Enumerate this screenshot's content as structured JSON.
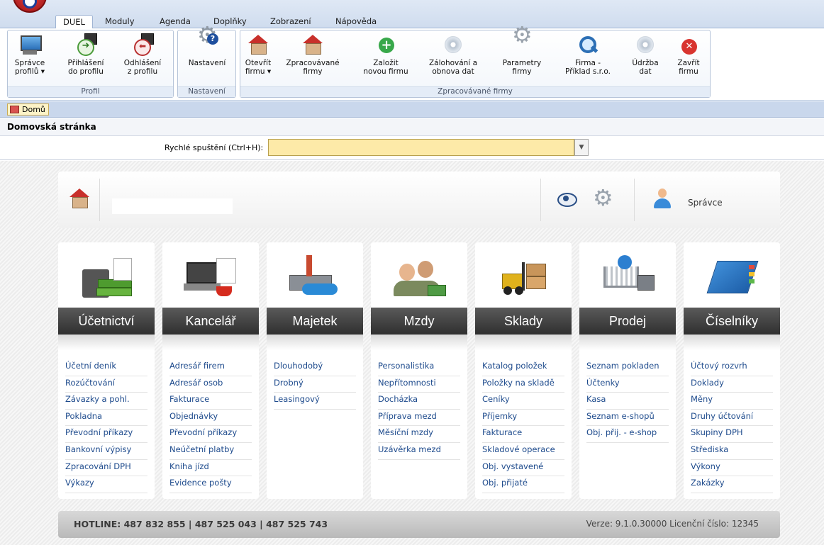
{
  "tabs": [
    "DUEL",
    "Moduly",
    "Agenda",
    "Doplňky",
    "Zobrazení",
    "Nápověda"
  ],
  "ribbon": {
    "groups": {
      "profil": "Profil",
      "nastaveni": "Nastavení",
      "firmy": "Zpracovávané firmy"
    },
    "buttons": {
      "spravce": [
        "Správce",
        "profilů ▾"
      ],
      "prihlaseni": [
        "Přihlášení",
        "do profilu"
      ],
      "odhlaseni": [
        "Odhlášení",
        "z profilu"
      ],
      "nastaveni": [
        "Nastavení"
      ],
      "otevrit": [
        "Otevřít",
        "firmu ▾"
      ],
      "zpracovavane": [
        "Zpracovávané",
        "firmy"
      ],
      "zalozit": [
        "Založit",
        "novou firmu"
      ],
      "zalohovani": [
        "Zálohování a",
        "obnova dat"
      ],
      "parametry": [
        "Parametry",
        "firmy"
      ],
      "firma": [
        "Firma -",
        "Příklad s.r.o."
      ],
      "udrzba": [
        "Údržba",
        "dat"
      ],
      "zavrit": [
        "Zavřít",
        "firmu"
      ]
    }
  },
  "breadcrumb": "Domů",
  "page_title": "Domovská stránka",
  "quick_launch": {
    "label": "Rychlé spuštění (Ctrl+H):",
    "value": ""
  },
  "user": "Správce",
  "modules": [
    {
      "title": "Účetnictví",
      "items": [
        "Účetní deník",
        "Rozúčtování",
        "Závazky a pohl.",
        "Pokladna",
        "Převodní příkazy",
        "Bankovní výpisy",
        "Zpracování DPH",
        "Výkazy"
      ]
    },
    {
      "title": "Kancelář",
      "items": [
        "Adresář firem",
        "Adresář osob",
        "Fakturace",
        "Objednávky",
        "Převodní příkazy",
        "Neúčetní platby",
        "Kniha jízd",
        "Evidence pošty"
      ]
    },
    {
      "title": "Majetek",
      "items": [
        "Dlouhodobý",
        "Drobný",
        "Leasingový"
      ]
    },
    {
      "title": "Mzdy",
      "items": [
        "Personalistika",
        "Nepřítomnosti",
        "Docházka",
        "Příprava mezd",
        "Měsíční mzdy",
        "Uzávěrka mezd"
      ]
    },
    {
      "title": "Sklady",
      "items": [
        "Katalog položek",
        "Položky na skladě",
        "Ceníky",
        "Příjemky",
        "Fakturace",
        "Skladové operace",
        "Obj. vystavené",
        "Obj. přijaté"
      ]
    },
    {
      "title": "Prodej",
      "items": [
        "Seznam pokladen",
        "Účtenky",
        "Kasa",
        "Seznam e-shopů",
        "Obj. přij. - e-shop"
      ]
    },
    {
      "title": "Číselníky",
      "items": [
        "Účtový rozvrh",
        "Doklady",
        "Měny",
        "Druhy účtování",
        "Skupiny DPH",
        "Střediska",
        "Výkony",
        "Zakázky"
      ]
    }
  ],
  "footer": {
    "hotline": "HOTLINE:  487 832 855  |  487 525 043  |  487 525 743",
    "version": "Verze: 9.1.0.30000  Licenční číslo: 12345"
  },
  "colors": {
    "link": "#1d4a8c",
    "module_header": "#3a3a3a",
    "quick_field": "#fdeaa8"
  }
}
